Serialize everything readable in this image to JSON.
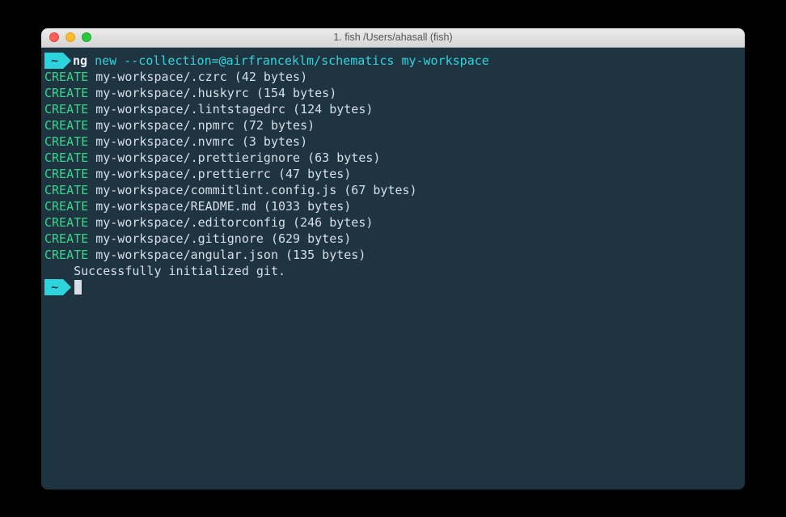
{
  "window": {
    "title": "1. fish /Users/ahasall (fish)"
  },
  "prompt": {
    "symbol": "~",
    "cmd_name": "ng",
    "cmd_sub": "new",
    "cmd_flag": "--collection=",
    "cmd_pkg": "@airfranceklm/schematics",
    "cmd_arg": "my-workspace"
  },
  "output": [
    {
      "action": "CREATE",
      "path": "my-workspace/.czrc (42 bytes)"
    },
    {
      "action": "CREATE",
      "path": "my-workspace/.huskyrc (154 bytes)"
    },
    {
      "action": "CREATE",
      "path": "my-workspace/.lintstagedrc (124 bytes)"
    },
    {
      "action": "CREATE",
      "path": "my-workspace/.npmrc (72 bytes)"
    },
    {
      "action": "CREATE",
      "path": "my-workspace/.nvmrc (3 bytes)"
    },
    {
      "action": "CREATE",
      "path": "my-workspace/.prettierignore (63 bytes)"
    },
    {
      "action": "CREATE",
      "path": "my-workspace/.prettierrc (47 bytes)"
    },
    {
      "action": "CREATE",
      "path": "my-workspace/commitlint.config.js (67 bytes)"
    },
    {
      "action": "CREATE",
      "path": "my-workspace/README.md (1033 bytes)"
    },
    {
      "action": "CREATE",
      "path": "my-workspace/.editorconfig (246 bytes)"
    },
    {
      "action": "CREATE",
      "path": "my-workspace/.gitignore (629 bytes)"
    },
    {
      "action": "CREATE",
      "path": "my-workspace/angular.json (135 bytes)"
    }
  ],
  "status": {
    "message": "    Successfully initialized git."
  }
}
